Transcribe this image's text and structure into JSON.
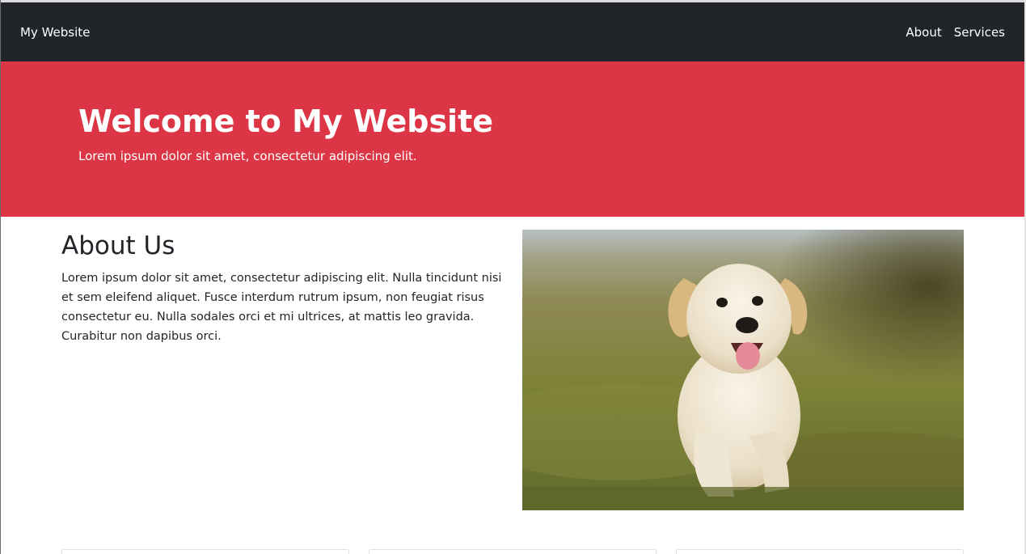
{
  "navbar": {
    "brand": "My Website",
    "links": [
      {
        "label": "About"
      },
      {
        "label": "Services"
      }
    ],
    "background": "#212529"
  },
  "hero": {
    "title": "Welcome to My Website",
    "subtitle": "Lorem ipsum dolor sit amet, consectetur adipiscing elit.",
    "background": "#dc3545"
  },
  "about": {
    "heading": "About Us",
    "body": "Lorem ipsum dolor sit amet, consectetur adipiscing elit. Nulla tincidunt nisi et sem eleifend aliquet. Fusce interdum rutrum ipsum, non feugiat risus consectetur eu. Nulla sodales orci et mi ultrices, at mattis leo gravida. Curabitur non dapibus orci.",
    "image": "puppy running on grass photo"
  },
  "cards": [
    {
      "name": "card-1"
    },
    {
      "name": "card-2"
    },
    {
      "name": "card-3"
    }
  ]
}
